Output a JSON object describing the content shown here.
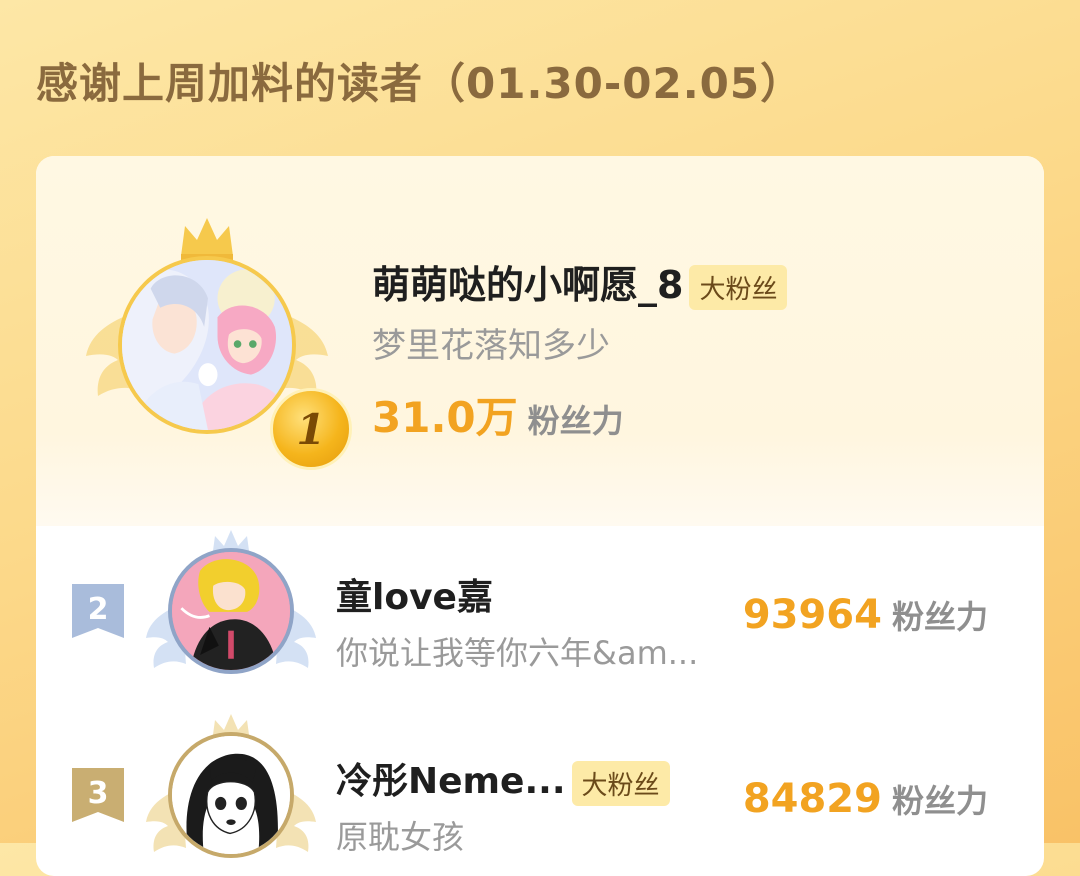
{
  "header": {
    "title": "感谢上周加料的读者（01.30-02.05）"
  },
  "colors": {
    "accent": "#f2a321",
    "badge_bg": "#fdeaa7",
    "gold": "#f5b51c",
    "silver": "#9fb3d4",
    "bronze": "#c6a96a"
  },
  "power_label": "粉丝力",
  "leaderboard": [
    {
      "rank": "1",
      "name": "萌萌哒的小啊愿_8",
      "badge": "大粉丝",
      "subtitle": "梦里花落知多少",
      "power": "31.0万",
      "avatar_icon": "anime-couple-avatar",
      "medal_icon": "gold-medal-icon"
    },
    {
      "rank": "2",
      "name": "童love嘉",
      "badge": "",
      "subtitle": "你说让我等你六年&am...",
      "power": "93964",
      "avatar_icon": "anime-character-avatar",
      "medal_icon": "silver-rank-tag-icon"
    },
    {
      "rank": "3",
      "name": "冷彤Neme...",
      "badge": "大粉丝",
      "subtitle": "原耽女孩",
      "power": "84829",
      "avatar_icon": "manga-girl-avatar",
      "medal_icon": "bronze-rank-tag-icon"
    }
  ]
}
